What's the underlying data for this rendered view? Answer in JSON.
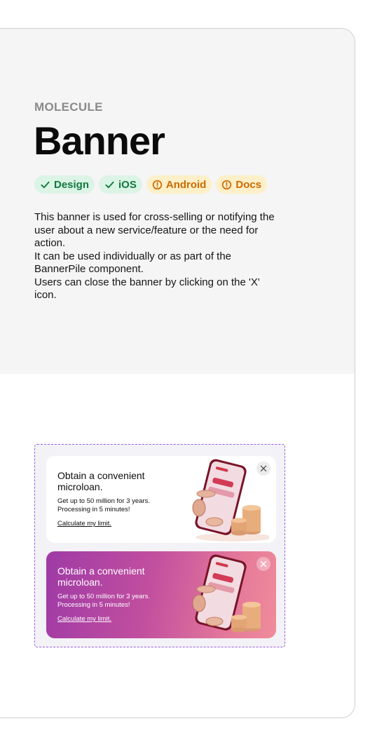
{
  "header": {
    "overline": "MOLECULE",
    "title": "Banner"
  },
  "tags": [
    {
      "label": "Design",
      "status": "done"
    },
    {
      "label": "iOS",
      "status": "done"
    },
    {
      "label": "Android",
      "status": "warning"
    },
    {
      "label": "Docs",
      "status": "warning"
    }
  ],
  "description": [
    "This banner is used for cross-selling or notifying the user about a new service/feature or the need for action.",
    "It can be used individually or as part of the BannerPile component.",
    "Users can close the banner by clicking on the 'X' icon."
  ],
  "banners": [
    {
      "variant": "white",
      "title": "Obtain a convenient microloan.",
      "subtitle": "Get up to 50 million for 3 years. Processing in 5 minutes!",
      "link": "Calculate my limit.",
      "close_icon": "close-icon"
    },
    {
      "variant": "pink",
      "title": "Obtain a convenient microloan.",
      "subtitle": "Get up to 50 million for 3 years. Processing in 5 minutes!",
      "link": "Calculate my limit.",
      "close_icon": "close-icon"
    }
  ],
  "colors": {
    "tag_done_bg": "#dcf4e6",
    "tag_done_text": "#0f7a3d",
    "tag_warn_bg": "#fdefc8",
    "tag_warn_text": "#cb6a00",
    "frame_border": "#9b5be6"
  }
}
